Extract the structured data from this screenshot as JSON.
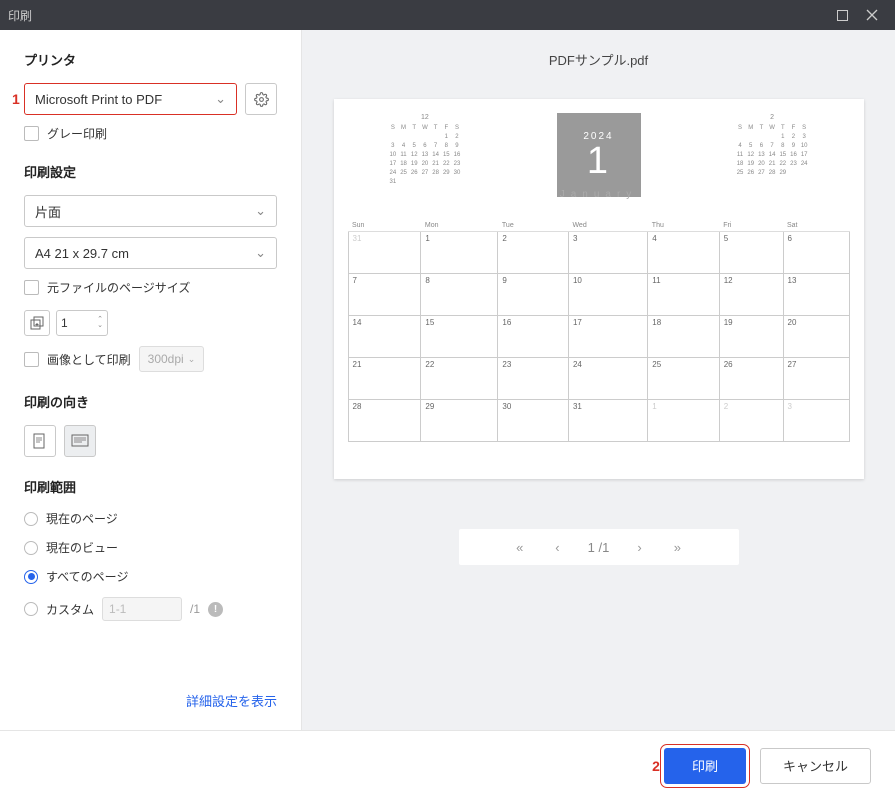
{
  "titlebar": {
    "title": "印刷"
  },
  "sidebar": {
    "printer_label": "プリンタ",
    "marker1": "1",
    "printer_select": "Microsoft Print to PDF",
    "grayscale": "グレー印刷",
    "print_settings_label": "印刷設定",
    "duplex": "片面",
    "paper": "A4 21 x 29.7 cm",
    "original_size": "元ファイルのページサイズ",
    "copies": "1",
    "print_as_image": "画像として印刷",
    "dpi": "300dpi",
    "orientation_label": "印刷の向き",
    "range_label": "印刷範囲",
    "range_current_page": "現在のページ",
    "range_current_view": "現在のビュー",
    "range_all": "すべてのページ",
    "range_custom": "カスタム",
    "custom_placeholder": "1-1",
    "custom_total": "/1",
    "advanced": "詳細設定を表示"
  },
  "preview": {
    "filename": "PDFサンプル.pdf",
    "mini_prev": {
      "label": "12",
      "head": [
        "S",
        "M",
        "T",
        "W",
        "T",
        "F",
        "S"
      ],
      "rows": [
        [
          "",
          "",
          "",
          "",
          "",
          "1",
          "2"
        ],
        [
          "3",
          "4",
          "5",
          "6",
          "7",
          "8",
          "9"
        ],
        [
          "10",
          "11",
          "12",
          "13",
          "14",
          "15",
          "16"
        ],
        [
          "17",
          "18",
          "19",
          "20",
          "21",
          "22",
          "23"
        ],
        [
          "24",
          "25",
          "26",
          "27",
          "28",
          "29",
          "30"
        ],
        [
          "31",
          "",
          "",
          "",
          "",
          "",
          ""
        ]
      ]
    },
    "big": {
      "year": "2024",
      "month": "1",
      "name": "January"
    },
    "mini_next": {
      "label": "2",
      "head": [
        "S",
        "M",
        "T",
        "W",
        "T",
        "F",
        "S"
      ],
      "rows": [
        [
          "",
          "",
          "",
          "",
          "1",
          "2",
          "3"
        ],
        [
          "4",
          "5",
          "6",
          "7",
          "8",
          "9",
          "10"
        ],
        [
          "11",
          "12",
          "13",
          "14",
          "15",
          "16",
          "17"
        ],
        [
          "18",
          "19",
          "20",
          "21",
          "22",
          "23",
          "24"
        ],
        [
          "25",
          "26",
          "27",
          "28",
          "29",
          "",
          ""
        ]
      ]
    },
    "grid": {
      "head": [
        "Sun",
        "Mon",
        "Tue",
        "Wed",
        "Thu",
        "Fri",
        "Sat"
      ],
      "rows": [
        [
          {
            "d": "31",
            "muted": true
          },
          {
            "d": "1"
          },
          {
            "d": "2"
          },
          {
            "d": "3"
          },
          {
            "d": "4"
          },
          {
            "d": "5"
          },
          {
            "d": "6"
          }
        ],
        [
          {
            "d": "7"
          },
          {
            "d": "8"
          },
          {
            "d": "9"
          },
          {
            "d": "10"
          },
          {
            "d": "11"
          },
          {
            "d": "12"
          },
          {
            "d": "13"
          }
        ],
        [
          {
            "d": "14"
          },
          {
            "d": "15"
          },
          {
            "d": "16"
          },
          {
            "d": "17"
          },
          {
            "d": "18"
          },
          {
            "d": "19"
          },
          {
            "d": "20"
          }
        ],
        [
          {
            "d": "21"
          },
          {
            "d": "22"
          },
          {
            "d": "23"
          },
          {
            "d": "24"
          },
          {
            "d": "25"
          },
          {
            "d": "26"
          },
          {
            "d": "27"
          }
        ],
        [
          {
            "d": "28"
          },
          {
            "d": "29"
          },
          {
            "d": "30"
          },
          {
            "d": "31"
          },
          {
            "d": "1",
            "muted": true
          },
          {
            "d": "2",
            "muted": true
          },
          {
            "d": "3",
            "muted": true
          }
        ]
      ]
    },
    "pager": {
      "current": "1",
      "sep": "/1"
    }
  },
  "footer": {
    "marker2": "2",
    "print": "印刷",
    "cancel": "キャンセル"
  }
}
